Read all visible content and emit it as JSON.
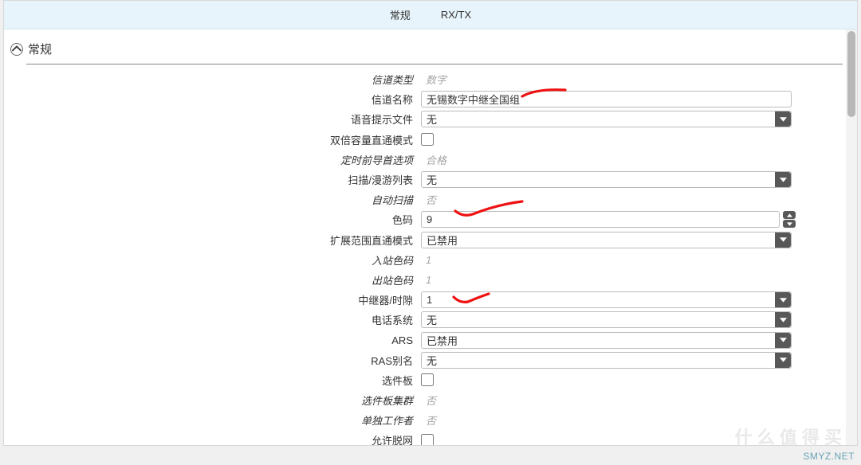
{
  "tabs": {
    "t1": "常规",
    "t2": "RX/TX"
  },
  "section": {
    "title": "常规"
  },
  "fields": {
    "channel_type": {
      "label": "信道类型",
      "value": "数字"
    },
    "channel_name": {
      "label": "信道名称",
      "value": "无锡数字中继全国组"
    },
    "voice_prompt": {
      "label": "语音提示文件",
      "value": "无"
    },
    "double_capacity": {
      "label": "双倍容量直通模式"
    },
    "timing_preamble": {
      "label": "定时前导首选项",
      "value": "合格"
    },
    "scan_roam_list": {
      "label": "扫描/漫游列表",
      "value": "无"
    },
    "auto_scan": {
      "label": "自动扫描",
      "value": "否"
    },
    "color_code": {
      "label": "色码",
      "value": "9"
    },
    "ext_range_mode": {
      "label": "扩展范围直通模式",
      "value": "已禁用"
    },
    "in_color_code": {
      "label": "入站色码",
      "value": "1"
    },
    "out_color_code": {
      "label": "出站色码",
      "value": "1"
    },
    "repeater_slot": {
      "label": "中继器/时隙",
      "value": "1"
    },
    "phone_system": {
      "label": "电话系统",
      "value": "无"
    },
    "ars": {
      "label": "ARS",
      "value": "已禁用"
    },
    "ras_alias": {
      "label": "RAS别名",
      "value": "无"
    },
    "option_board": {
      "label": "选件板"
    },
    "option_trunk": {
      "label": "选件板集群",
      "value": "否"
    },
    "lone_worker": {
      "label": "单独工作者",
      "value": "否"
    },
    "allow_offgrid": {
      "label": "允许脱网"
    }
  },
  "footer": {
    "watermark": "SMYZ.NET",
    "bg": "什 么 值 得 买"
  }
}
